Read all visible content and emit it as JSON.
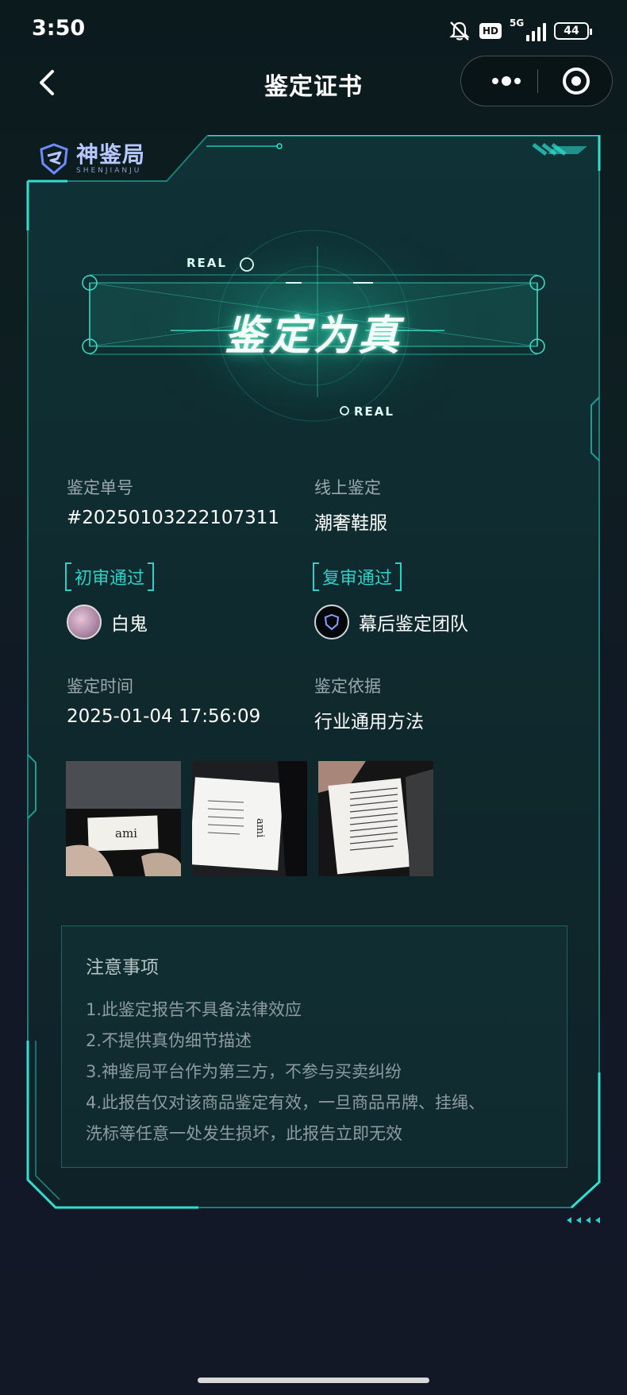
{
  "status_bar": {
    "time": "3:50",
    "hd": "HD",
    "network": "5G",
    "battery": "44"
  },
  "nav": {
    "title": "鉴定证书"
  },
  "brand": {
    "name": "神鉴局",
    "sub": "SHENJIANJU"
  },
  "result": {
    "title": "鉴定为真",
    "tag_top": "REAL",
    "tag_bottom": "REAL"
  },
  "info": {
    "order_label": "鉴定单号",
    "order_value": "#20250103222107311",
    "channel_label": "线上鉴定",
    "channel_value": "潮奢鞋服",
    "first_review": "初审通过",
    "second_review": "复审通过",
    "first_reviewer": "白鬼",
    "second_reviewer": "幕后鉴定团队",
    "time_label": "鉴定时间",
    "time_value": "2025-01-04 17:56:09",
    "basis_label": "鉴定依据",
    "basis_value": "行业通用方法"
  },
  "photos": [
    {
      "label": "ami"
    },
    {
      "label": "ami"
    },
    {
      "label": ""
    }
  ],
  "notice": {
    "title": "注意事项",
    "lines": [
      "1.此鉴定报告不具备法律效应",
      "2.不提供真伪细节描述",
      "3.神鉴局平台作为第三方，不参与买卖纠纷",
      "4.此报告仅对该商品鉴定有效，一旦商品吊牌、挂绳、",
      "洗标等任意一处发生损坏，此报告立即无效"
    ]
  },
  "colors": {
    "accent": "#2fd0c5",
    "background": "#111a24"
  }
}
